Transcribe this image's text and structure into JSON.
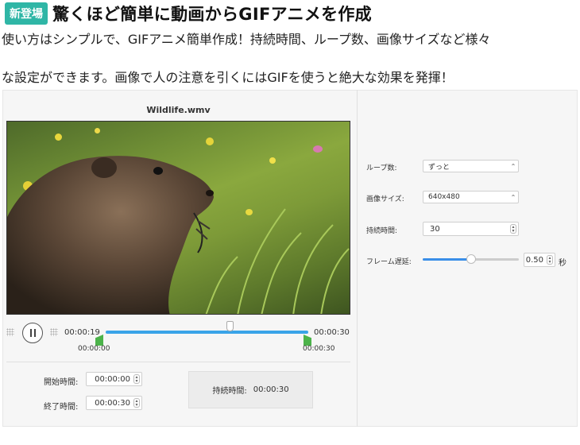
{
  "header": {
    "badge": "新登場",
    "title": "驚くほど簡単に動画からGIFアニメを作成",
    "desc_line1": "使い方はシンプルで、GIFアニメ簡単作成！持続時間、ループ数、画像サイズなど様々",
    "desc_line2": "な設定ができます。画像で人の注意を引くにはGIFを使うと絶大な効果を発揮！"
  },
  "player": {
    "filename": "Wildlife.wmv",
    "current_time": "00:00:19",
    "end_time": "00:00:30",
    "start_marker": "00:00:00",
    "end_marker": "00:00:30",
    "playhead_fraction": 0.63
  },
  "trim": {
    "start_label": "開始時間:",
    "start_value": "00:00:00",
    "end_label": "終了時間:",
    "end_value": "00:00:30",
    "duration_label": "持続時間:",
    "duration_value": "00:00:30"
  },
  "settings": {
    "loop_label": "ループ数:",
    "loop_value": "ずっと",
    "size_label": "画像サイズ:",
    "size_value": "640x480",
    "duration_label": "持続時間:",
    "duration_value": "30",
    "delay_label": "フレーム遅延:",
    "delay_value": "0.50",
    "delay_unit": "秒",
    "delay_fraction": 0.5
  },
  "colors": {
    "badge": "#2fb6a6",
    "timeline": "#3aa4e8",
    "trim_handle": "#4cb34a",
    "slider": "#3a8ee8"
  }
}
